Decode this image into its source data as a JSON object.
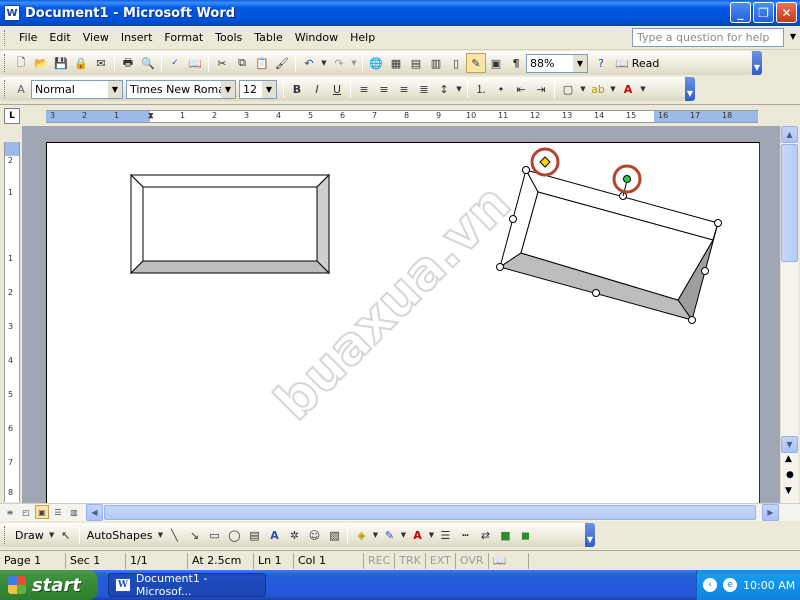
{
  "window": {
    "title": "Document1 - Microsoft Word"
  },
  "menu": {
    "items": [
      "File",
      "Edit",
      "View",
      "Insert",
      "Format",
      "Tools",
      "Table",
      "Window",
      "Help"
    ],
    "help_placeholder": "Type a question for help"
  },
  "standard_toolbar": {
    "zoom": "88%",
    "read_label": "Read"
  },
  "formatting_toolbar": {
    "style": "Normal",
    "font": "Times New Roman",
    "size": "12"
  },
  "ruler": {
    "h_labels": [
      "3",
      "2",
      "1",
      "1",
      "2",
      "3",
      "4",
      "5",
      "6",
      "7",
      "8",
      "9",
      "10",
      "11",
      "12",
      "13",
      "14",
      "15",
      "16",
      "17",
      "18"
    ],
    "v_labels": [
      "2",
      "1",
      "1",
      "2",
      "3",
      "4",
      "5",
      "6",
      "7",
      "8"
    ]
  },
  "document": {
    "watermark": "buaxua.vn"
  },
  "drawing_toolbar": {
    "draw_label": "Draw",
    "autoshapes_label": "AutoShapes"
  },
  "status": {
    "page": "Page 1",
    "sec": "Sec 1",
    "pages": "1/1",
    "at": "At 2.5cm",
    "ln": "Ln 1",
    "col": "Col 1",
    "rec": "REC",
    "trk": "TRK",
    "ext": "EXT",
    "ovr": "OVR"
  },
  "taskbar": {
    "start_label": "start",
    "task_item": "Document1 - Microsof...",
    "clock": "10:00 AM"
  },
  "colors": {
    "title_blue": "#0054e3",
    "taskbar_blue": "#245edb",
    "start_green": "#3a8f3a",
    "selection_ring": "#b5442a"
  }
}
